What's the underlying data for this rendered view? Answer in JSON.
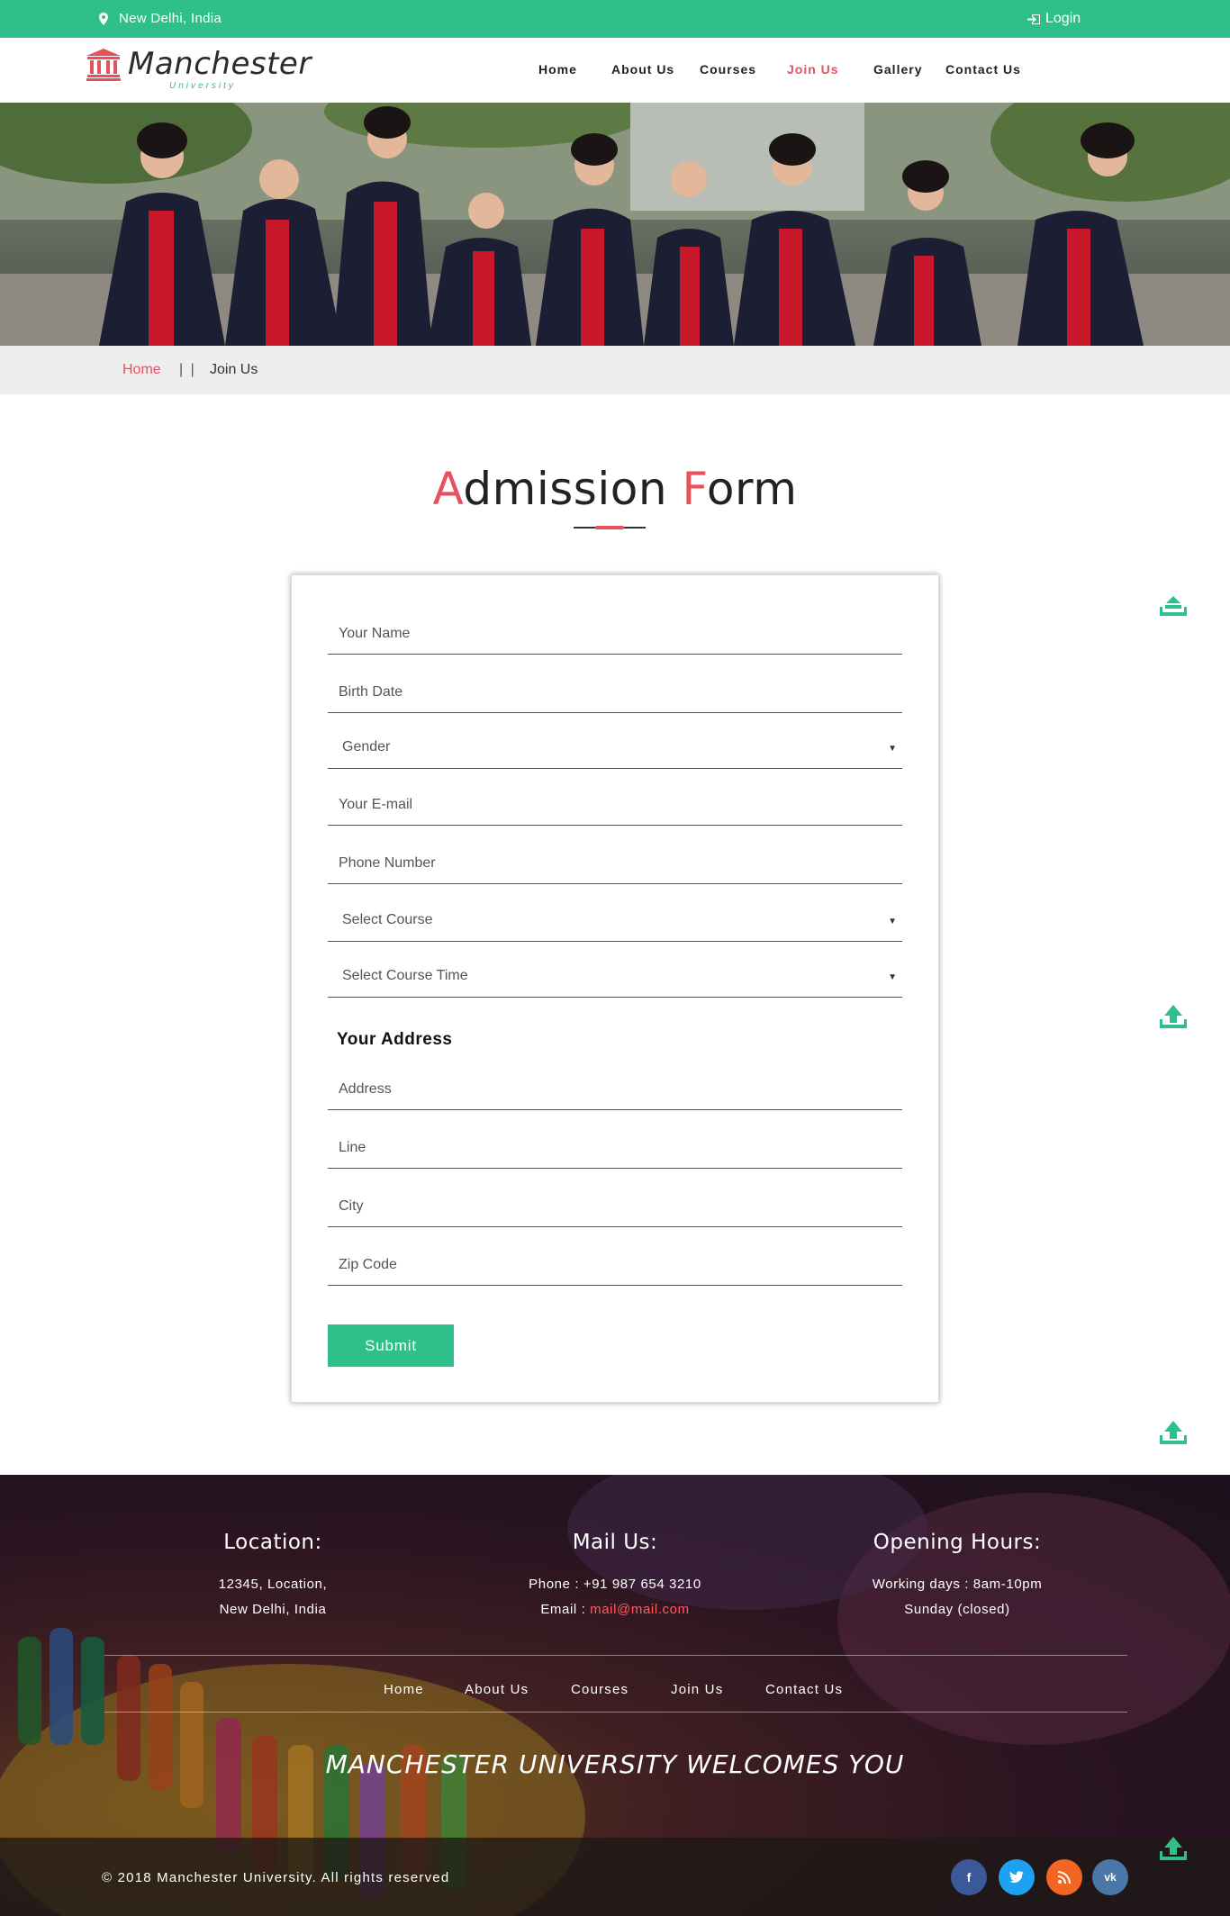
{
  "topbar": {
    "location": "New Delhi, India",
    "login_label": "Login"
  },
  "brand": {
    "name": "Manchester",
    "subtitle": "University",
    "accent": "#e8505b",
    "primary": "#2fbf8a"
  },
  "nav": {
    "items": [
      {
        "label": "Home"
      },
      {
        "label": "About Us"
      },
      {
        "label": "Courses"
      },
      {
        "label": "Join Us",
        "active": true
      },
      {
        "label": "Gallery"
      },
      {
        "label": "Contact Us"
      }
    ]
  },
  "breadcrumb": {
    "home": "Home",
    "separator": "| |",
    "current": "Join Us"
  },
  "form": {
    "title_first_letter": "A",
    "title_word1_rest": "dmission ",
    "title_second_letter": "F",
    "title_word2_rest": "orm",
    "name_placeholder": "Your Name",
    "birth_placeholder": "Birth Date",
    "gender_value": "Gender",
    "email_placeholder": "Your E-mail",
    "phone_placeholder": "Phone Number",
    "course_value": "Select Course",
    "course_time_value": "Select Course Time",
    "address_heading": "Your Address",
    "address_placeholder": "Address",
    "line_placeholder": "Line",
    "city_placeholder": "City",
    "zip_placeholder": "Zip Code",
    "submit_label": "Submit"
  },
  "footer": {
    "location_title": "Location:",
    "location_line1": "12345, Location,",
    "location_line2": "New Delhi, India",
    "mail_title": "Mail Us:",
    "phone_line": "Phone : +91 987 654 3210",
    "email_prefix": "Email : ",
    "email": "mail@mail.com",
    "hours_title": "Opening Hours:",
    "hours_line1": "Working days : 8am-10pm",
    "hours_line2": "Sunday (closed)",
    "nav": [
      "Home",
      "About Us",
      "Courses",
      "Join Us",
      "Contact Us"
    ],
    "welcome": "MANCHESTER UNIVERSITY WELCOMES YOU",
    "copyright": "© 2018 Manchester University. All rights reserved",
    "social": [
      {
        "icon": "facebook-icon",
        "glyph": "f",
        "color": "#3b5998"
      },
      {
        "icon": "twitter-icon",
        "glyph": "t",
        "color": "#1da1f2"
      },
      {
        "icon": "rss-icon",
        "glyph": "r",
        "color": "#f26522"
      },
      {
        "icon": "vk-icon",
        "glyph": "vk",
        "color": "#4a76a8"
      }
    ]
  }
}
